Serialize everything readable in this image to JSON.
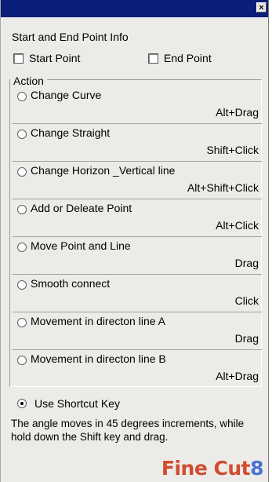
{
  "window": {
    "close_label": "×"
  },
  "info": {
    "title": "Start and End Point Info",
    "start_point": {
      "label": "Start Point",
      "checked": false
    },
    "end_point": {
      "label": "End Point",
      "checked": false
    }
  },
  "action": {
    "legend": "Action",
    "items": [
      {
        "label": "Change Curve",
        "shortcut": "Alt+Drag",
        "selected": false
      },
      {
        "label": "Change Straight",
        "shortcut": "Shift+Click",
        "selected": false
      },
      {
        "label": "Change Horizon _Vertical line",
        "shortcut": "Alt+Shift+Click",
        "selected": false
      },
      {
        "label": "Add or Deleate Point",
        "shortcut": "Alt+Click",
        "selected": false
      },
      {
        "label": "Move Point and Line",
        "shortcut": "Drag",
        "selected": false
      },
      {
        "label": "Smooth connect",
        "shortcut": "Click",
        "selected": false
      },
      {
        "label": "Movement in directon line A",
        "shortcut": "Drag",
        "selected": false
      },
      {
        "label": "Movement in directon line B",
        "shortcut": "Alt+Drag",
        "selected": false
      }
    ]
  },
  "shortcut_key": {
    "label": "Use Shortcut Key",
    "selected": true
  },
  "note": "The angle moves in 45 degrees increments, while hold down the Shift key and drag.",
  "logo": {
    "text": "Fine Cut",
    "number": "8"
  }
}
